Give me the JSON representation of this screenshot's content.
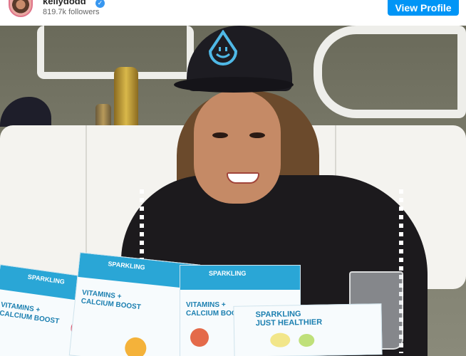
{
  "header": {
    "username": "kellydodd",
    "verified_icon": "verified-badge-icon",
    "followers": "819.7k followers",
    "view_profile_label": "View Profile"
  },
  "photo": {
    "box_labels": {
      "sparkling": "SPARKLING",
      "just_healthier": "JUST HEALTHIER",
      "vitamins": "VITAMINS +",
      "calcium": "CALCIUM BOOST"
    }
  },
  "colors": {
    "button_blue": "#0095f6",
    "verified_blue": "#3897f0",
    "box_blue": "#2aa6d6"
  }
}
